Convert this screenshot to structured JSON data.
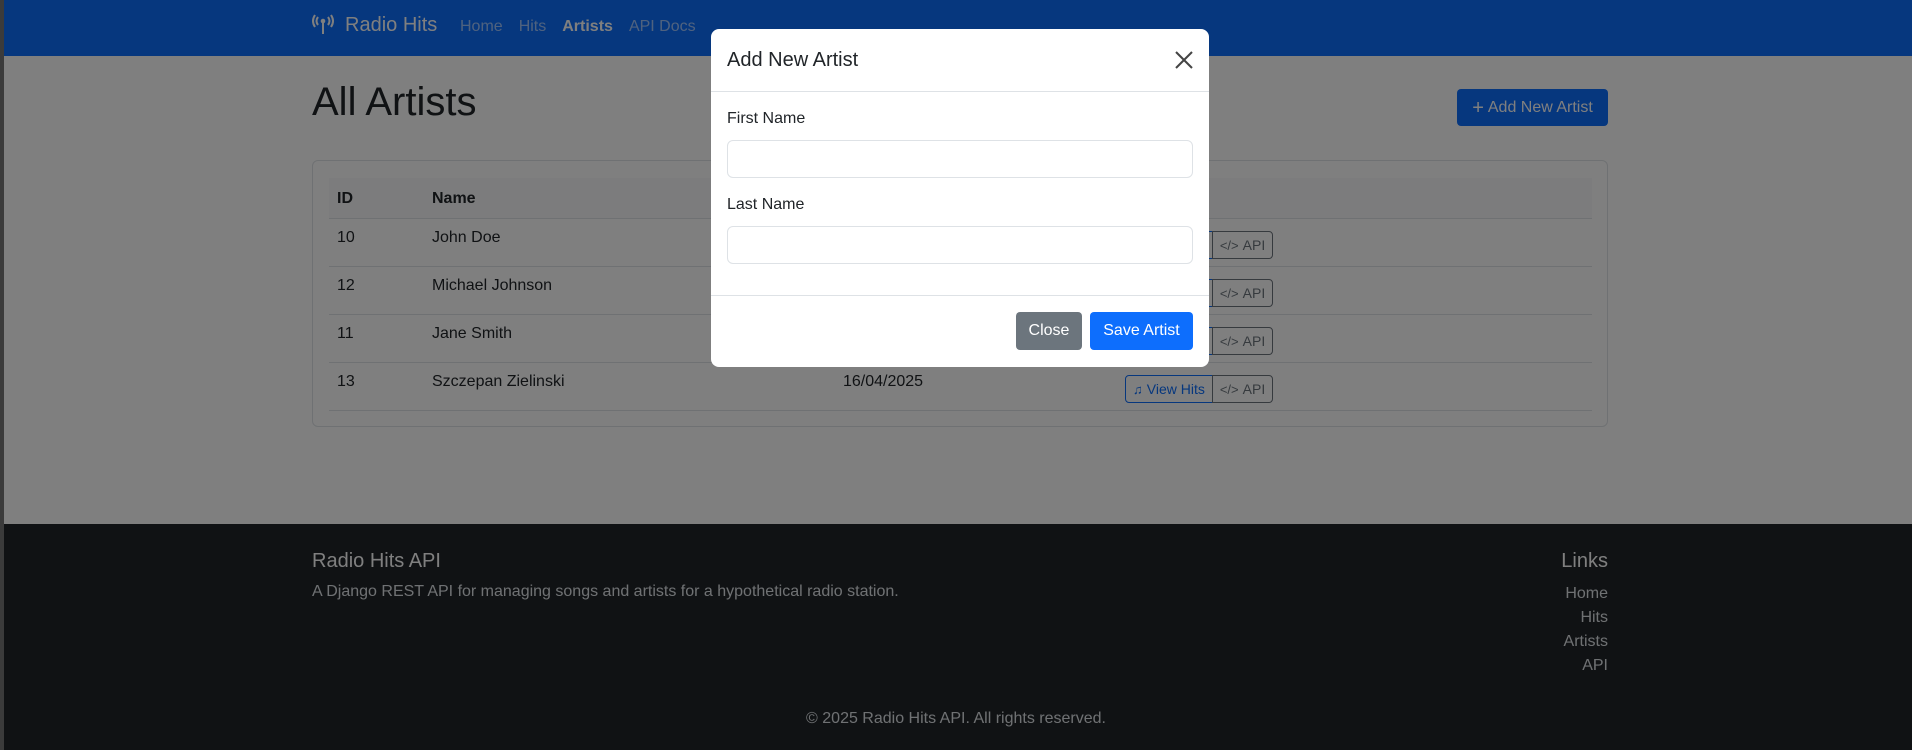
{
  "navbar": {
    "brand": "Radio Hits",
    "links": [
      {
        "label": "Home"
      },
      {
        "label": "Hits"
      },
      {
        "label": "Artists"
      },
      {
        "label": "API Docs"
      }
    ]
  },
  "main": {
    "title": "All Artists",
    "add_button_label": "Add New Artist",
    "table": {
      "headers": [
        "ID",
        "Name"
      ],
      "rows": [
        {
          "id": "10",
          "name": "John Doe",
          "date": ""
        },
        {
          "id": "12",
          "name": "Michael Johnson",
          "date": ""
        },
        {
          "id": "11",
          "name": "Jane Smith",
          "date": ""
        },
        {
          "id": "13",
          "name": "Szczepan Zielinski",
          "date": "16/04/2025"
        }
      ],
      "view_hits_label": "View Hits",
      "api_label": "API"
    }
  },
  "modal": {
    "title": "Add New Artist",
    "first_name_label": "First Name",
    "first_name_value": "",
    "last_name_label": "Last Name",
    "last_name_value": "",
    "close_label": "Close",
    "save_label": "Save Artist"
  },
  "footer": {
    "title": "Radio Hits API",
    "description": "A Django REST API for managing songs and artists for a hypothetical radio station.",
    "links_title": "Links",
    "links": [
      "Home",
      "Hits",
      "Artists",
      "API"
    ],
    "copyright": "© 2025 Radio Hits API. All rights reserved."
  },
  "colors": {
    "primary": "#0d6efd",
    "secondary": "#6c757d",
    "footer_bg": "#212529"
  }
}
